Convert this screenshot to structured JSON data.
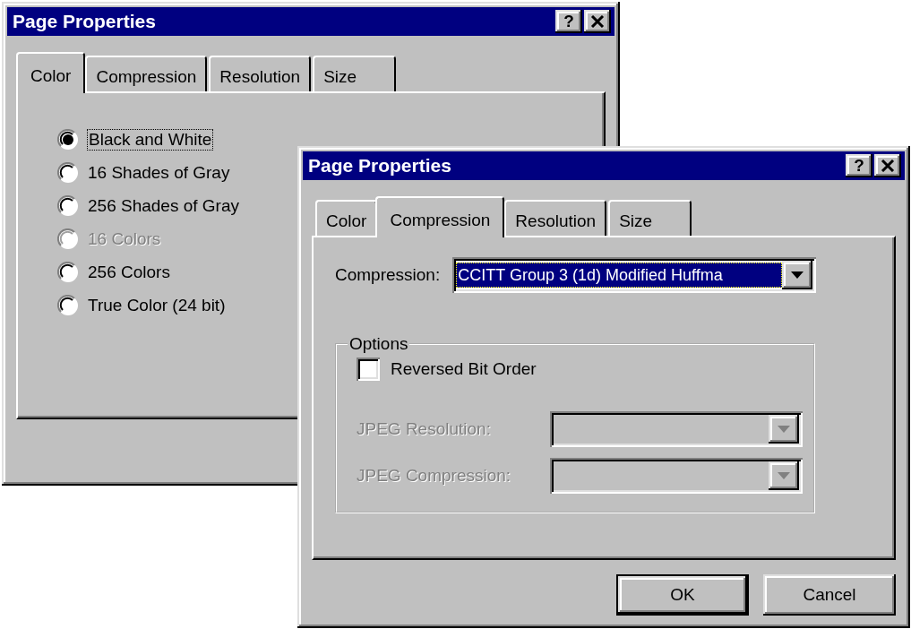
{
  "windows": [
    {
      "title": "Page Properties",
      "active": true,
      "help_button": "?",
      "tabs": [
        {
          "label": "Color",
          "selected": true
        },
        {
          "label": "Compression",
          "selected": false
        },
        {
          "label": "Resolution",
          "selected": false
        },
        {
          "label": "Size",
          "selected": false
        }
      ],
      "page": {
        "kind": "radio_list",
        "options": [
          {
            "label": "Black and White",
            "selected": true,
            "disabled": false,
            "focused": true
          },
          {
            "label": "16 Shades of Gray",
            "selected": false,
            "disabled": false,
            "focused": false
          },
          {
            "label": "256 Shades of Gray",
            "selected": false,
            "disabled": false,
            "focused": false
          },
          {
            "label": "16 Colors",
            "selected": false,
            "disabled": true,
            "focused": false
          },
          {
            "label": "256 Colors",
            "selected": false,
            "disabled": false,
            "focused": false
          },
          {
            "label": "True Color (24 bit)",
            "selected": false,
            "disabled": false,
            "focused": false
          }
        ]
      }
    },
    {
      "title": "Page Properties",
      "active": true,
      "help_button": "?",
      "tabs": [
        {
          "label": "Color",
          "selected": false
        },
        {
          "label": "Compression",
          "selected": true
        },
        {
          "label": "Resolution",
          "selected": false
        },
        {
          "label": "Size",
          "selected": false
        }
      ],
      "page": {
        "kind": "compression_form",
        "compression": {
          "label": "Compression:",
          "value": "CCITT Group 3 (1d) Modified Huffma",
          "focused": true
        },
        "options": {
          "title": "Options",
          "checkbox": {
            "label": "Reversed Bit Order",
            "checked": false
          },
          "fields": [
            {
              "label": "JPEG Resolution:",
              "disabled": true
            },
            {
              "label": "JPEG Compression:",
              "disabled": true
            }
          ]
        }
      },
      "buttons": [
        {
          "label": "OK",
          "default": true
        },
        {
          "label": "Cancel",
          "default": false
        }
      ]
    }
  ]
}
